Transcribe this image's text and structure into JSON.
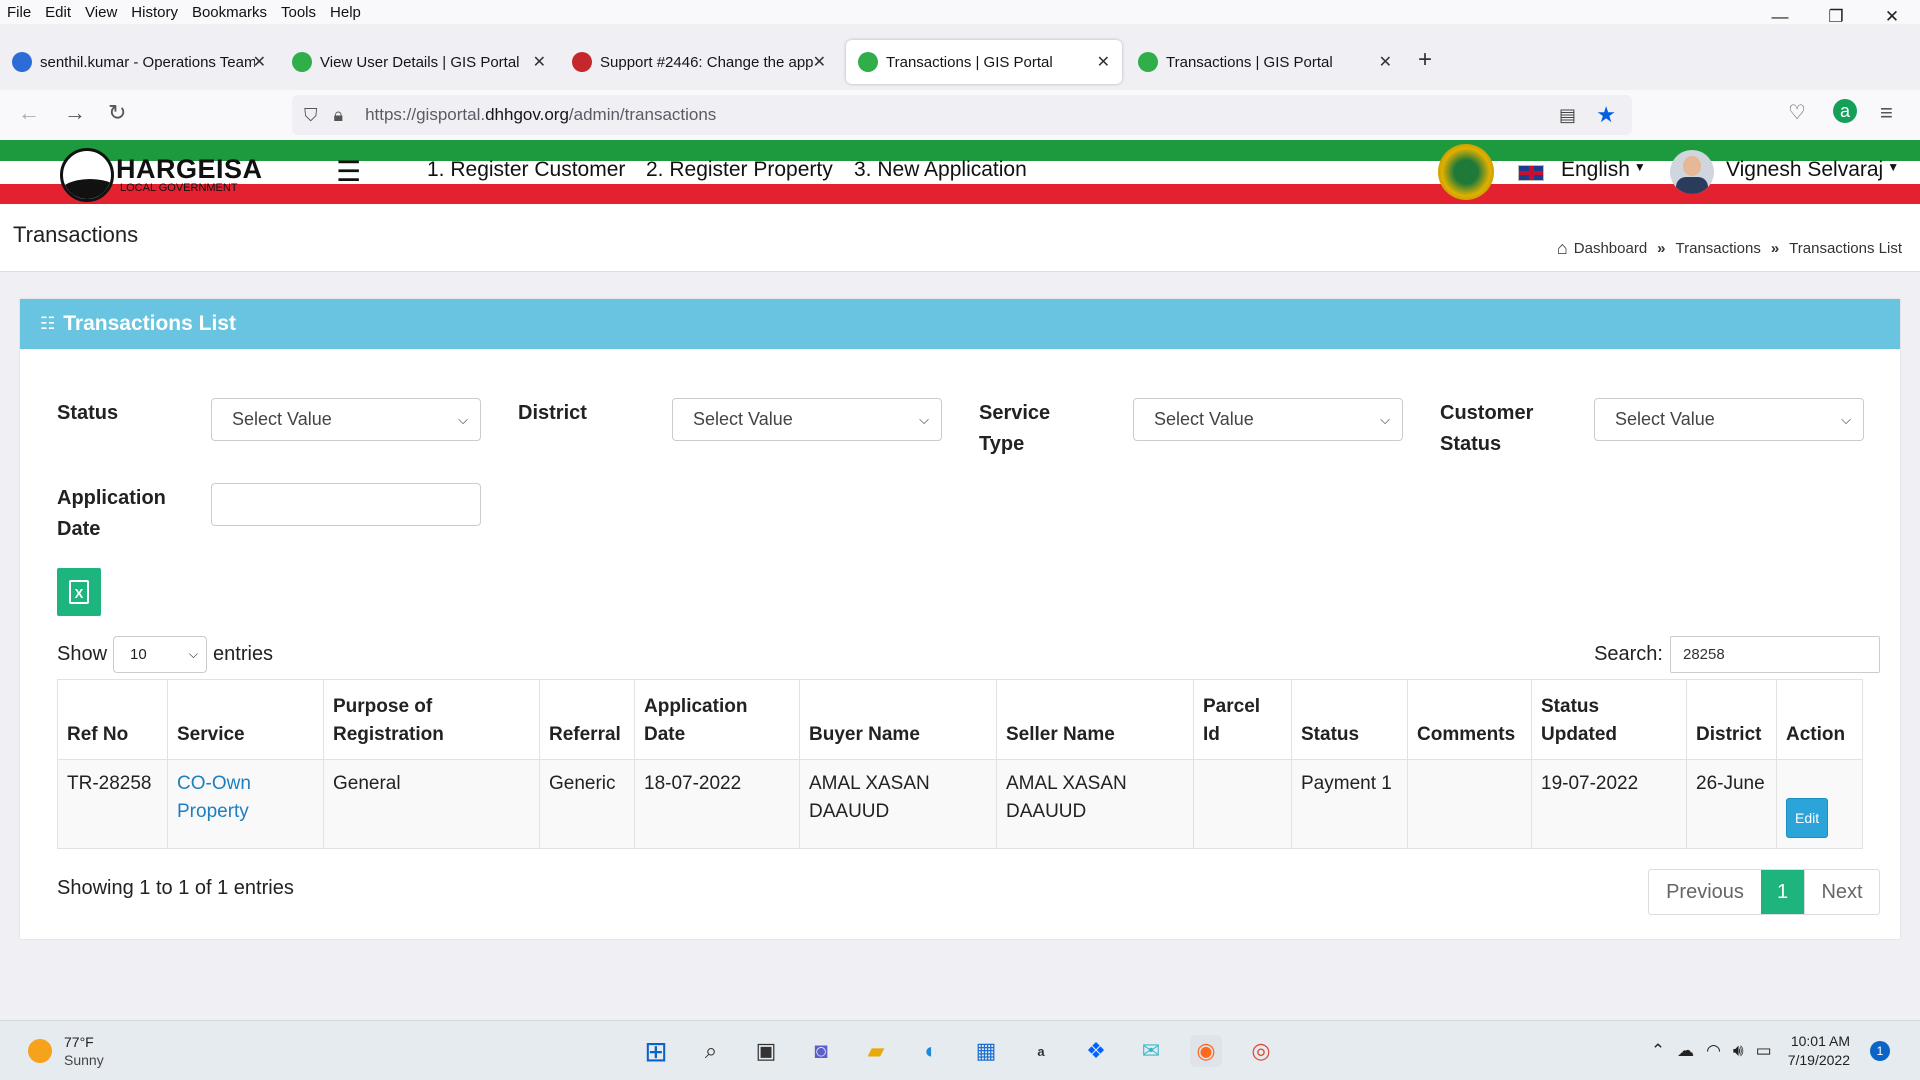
{
  "browser": {
    "menu": [
      "File",
      "Edit",
      "View",
      "History",
      "Bookmarks",
      "Tools",
      "Help"
    ],
    "window_controls": {
      "minimize": "—",
      "restore": "❐",
      "close": "✕"
    },
    "tabs": [
      {
        "title": "senthil.kumar - Operations Team",
        "favicon_color": "#2d6bd6",
        "close": "✕"
      },
      {
        "title": "View User Details | GIS Portal",
        "favicon_color": "#2fae4a",
        "close": "✕"
      },
      {
        "title": "Support #2446: Change the app",
        "favicon_color": "#c4282b",
        "close": "✕"
      },
      {
        "title": "Transactions | GIS Portal",
        "favicon_color": "#2fae4a",
        "close": "✕"
      },
      {
        "title": "Transactions | GIS Portal",
        "favicon_color": "#2fae4a",
        "close": "✕"
      }
    ],
    "new_tab": "+",
    "url_prefix": "https://gisportal.",
    "url_domain": "dhhgov.org",
    "url_path": "/admin/transactions"
  },
  "site": {
    "logo_title": "HARGEISA",
    "logo_subtitle": "LOCAL GOVERNMENT",
    "nav": [
      "1. Register Customer",
      "2. Register Property",
      "3. New Application"
    ],
    "language": "English",
    "user_name": "Vignesh Selvaraj",
    "colors": {
      "green": "#1e9a3e",
      "red": "#e4212f",
      "header_bar": "#68c4e0",
      "accent": "#1db47e"
    }
  },
  "page": {
    "title": "Transactions",
    "breadcrumbs": [
      "Dashboard",
      "Transactions",
      "Transactions List"
    ],
    "breadcrumb_sep": "»"
  },
  "card": {
    "title": "Transactions List",
    "filters": {
      "status_label": "Status",
      "district_label": "District",
      "service_label_1": "Service",
      "service_label_2": "Type",
      "customer_label_1": "Customer",
      "customer_label_2": "Status",
      "appdate_label_1": "Application",
      "appdate_label_2": "Date",
      "select_placeholder": "Select Value"
    },
    "excel_icon": "X",
    "show_label": "Show",
    "entries_label": "entries",
    "page_length": "10",
    "search_label": "Search:",
    "search_value": "28258",
    "columns": [
      "Ref No",
      "Service",
      "Purpose of Registration",
      "Referral",
      "Application Date",
      "Buyer Name",
      "Seller Name",
      "Parcel Id",
      "Status",
      "Comments",
      "Status Updated",
      "District",
      "Action"
    ],
    "rows": [
      {
        "ref_no": "TR-28258",
        "service": "CO-Own Property",
        "purpose": "General",
        "referral": "Generic",
        "application_date": "18-07-2022",
        "buyer": "AMAL XASAN DAAUUD",
        "seller": "AMAL XASAN DAAUUD",
        "parcel_id": "",
        "status": "Payment 1",
        "comments": "",
        "status_updated": "19-07-2022",
        "district": "26-June",
        "action": "Edit"
      }
    ],
    "info": "Showing 1 to 1 of 1 entries",
    "pager": {
      "previous": "Previous",
      "current": "1",
      "next": "Next"
    }
  },
  "taskbar": {
    "temperature": "77°F",
    "condition": "Sunny",
    "time": "10:01 AM",
    "date": "7/19/2022",
    "notifications": "1"
  }
}
